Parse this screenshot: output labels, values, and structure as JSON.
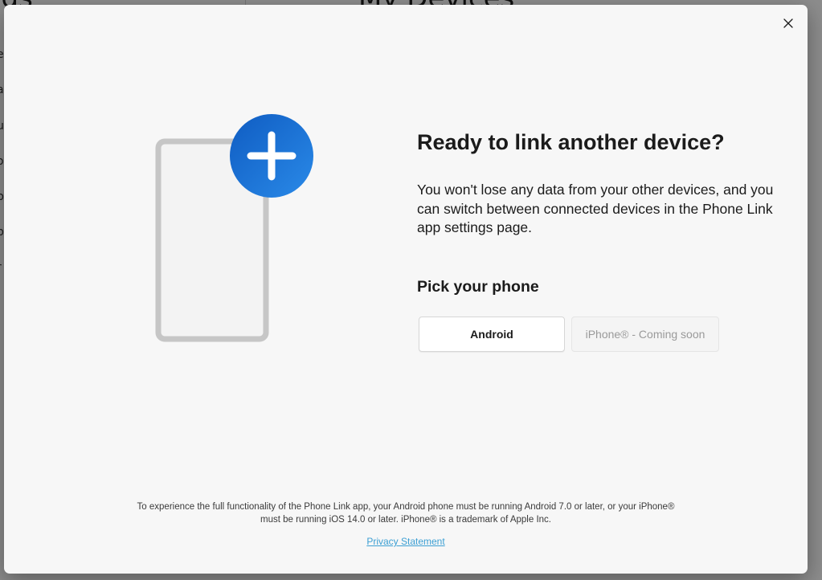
{
  "background": {
    "sidebar_title": "nds",
    "main_title": "My Devices",
    "sidebar_letters": [
      "e",
      "a",
      "u",
      "o",
      "p",
      "b",
      "r"
    ]
  },
  "dialog": {
    "title": "Ready to link another device?",
    "description": "You won't lose any data from your other devices, and you can switch between connected devices in the Phone Link app settings page.",
    "pick_heading": "Pick your phone",
    "android_label": "Android",
    "iphone_label": "iPhone® - Coming soon",
    "footer_line1": "To experience the full functionality of the Phone Link app, your Android phone must be running Android 7.0 or later, or your iPhone®",
    "footer_line2": "must be running iOS 14.0 or later. iPhone® is a trademark of Apple Inc.",
    "privacy_label": "Privacy Statement"
  },
  "colors": {
    "accent": "#1a6fd1",
    "link": "#3c9fd3",
    "phone_outline": "#c6c6c6"
  },
  "icons": {
    "close": "close-icon",
    "phone": "phone-outline-icon",
    "add": "plus-icon"
  }
}
